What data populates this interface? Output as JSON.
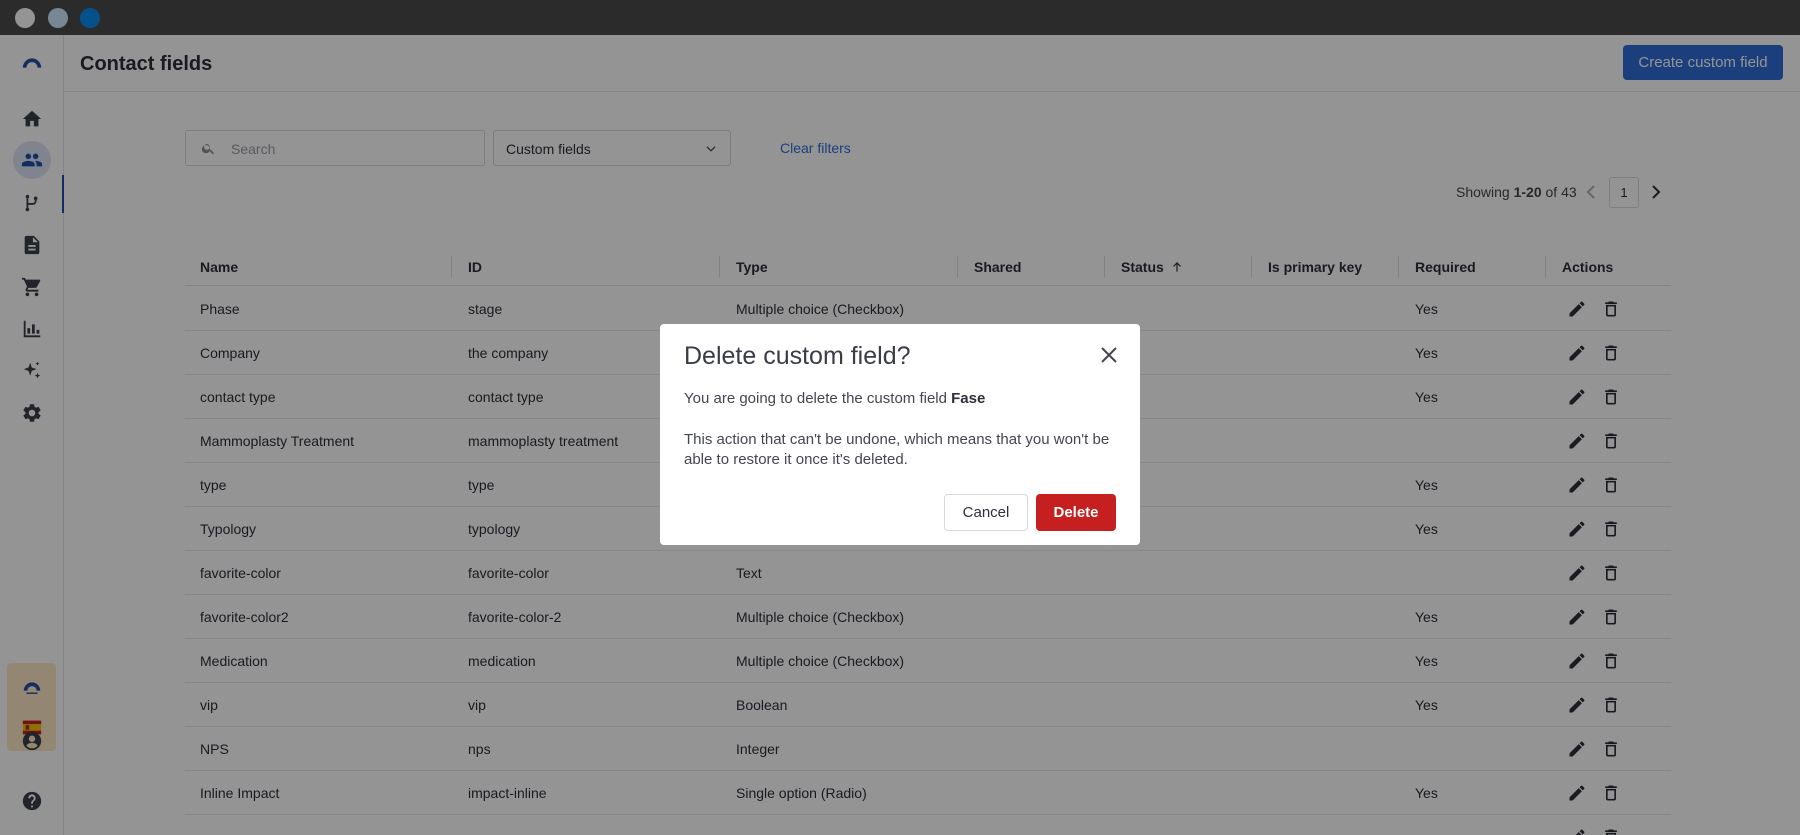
{
  "window": {
    "dots": [
      "close",
      "minimize",
      "maximize"
    ]
  },
  "header": {
    "title": "Contact fields",
    "create_label": "Create custom field"
  },
  "filters": {
    "search_placeholder": "Search",
    "select_value": "Custom fields",
    "clear_label": "Clear filters"
  },
  "pagination": {
    "showing_prefix": "Showing ",
    "showing_range": "1-20",
    "showing_suffix": " of 43",
    "current_page": "1"
  },
  "table": {
    "columns": [
      "Name",
      "ID",
      "Type",
      "Shared",
      "Status",
      "Is primary key",
      "Required",
      "Actions"
    ],
    "status_sort": "ascending",
    "rows": [
      {
        "name": "Phase",
        "id": "stage",
        "type": "Multiple choice (Checkbox)",
        "required": "Yes"
      },
      {
        "name": "Company",
        "id": "the company",
        "type": "",
        "required": "Yes"
      },
      {
        "name": "contact type",
        "id": "contact type",
        "type": "",
        "required": "Yes"
      },
      {
        "name": "Mammoplasty Treatment",
        "id": "mammoplasty treatment",
        "type": "",
        "required": ""
      },
      {
        "name": "type",
        "id": "type",
        "type": "",
        "required": "Yes"
      },
      {
        "name": "Typology",
        "id": "typology",
        "type": "",
        "required": "Yes"
      },
      {
        "name": "favorite-color",
        "id": "favorite-color",
        "type": "Text",
        "required": ""
      },
      {
        "name": "favorite-color2",
        "id": "favorite-color-2",
        "type": "Multiple choice (Checkbox)",
        "required": "Yes"
      },
      {
        "name": "Medication",
        "id": "medication",
        "type": "Multiple choice (Checkbox)",
        "required": "Yes"
      },
      {
        "name": "vip",
        "id": "vip",
        "type": "Boolean",
        "required": "Yes"
      },
      {
        "name": "NPS",
        "id": "nps",
        "type": "Integer",
        "required": ""
      },
      {
        "name": "Inline Impact",
        "id": "impact-inline",
        "type": "Single option (Radio)",
        "required": "Yes"
      },
      {
        "name": "",
        "id": "",
        "type": "",
        "required": ""
      }
    ]
  },
  "modal": {
    "title": "Delete custom field?",
    "text_prefix": "You are going to delete the custom field ",
    "field_name": "Fase",
    "text_body": "This action that can't be undone, which means that you won't be able to restore it once it's deleted.",
    "cancel_label": "Cancel",
    "delete_label": "Delete"
  },
  "sidebar": {
    "icons": [
      "logo-icon",
      "home-icon",
      "contacts-icon",
      "flows-icon",
      "documents-icon",
      "cart-icon",
      "reports-icon",
      "ai-sparkle-icon",
      "settings-icon",
      "brand-icon",
      "language-flag-icon",
      "user-account-icon",
      "help-icon"
    ],
    "active": "contacts-icon"
  },
  "colors": {
    "primary": "#2f6bd6",
    "danger": "#c61f1f",
    "accent_bg": "#fde8c7"
  }
}
